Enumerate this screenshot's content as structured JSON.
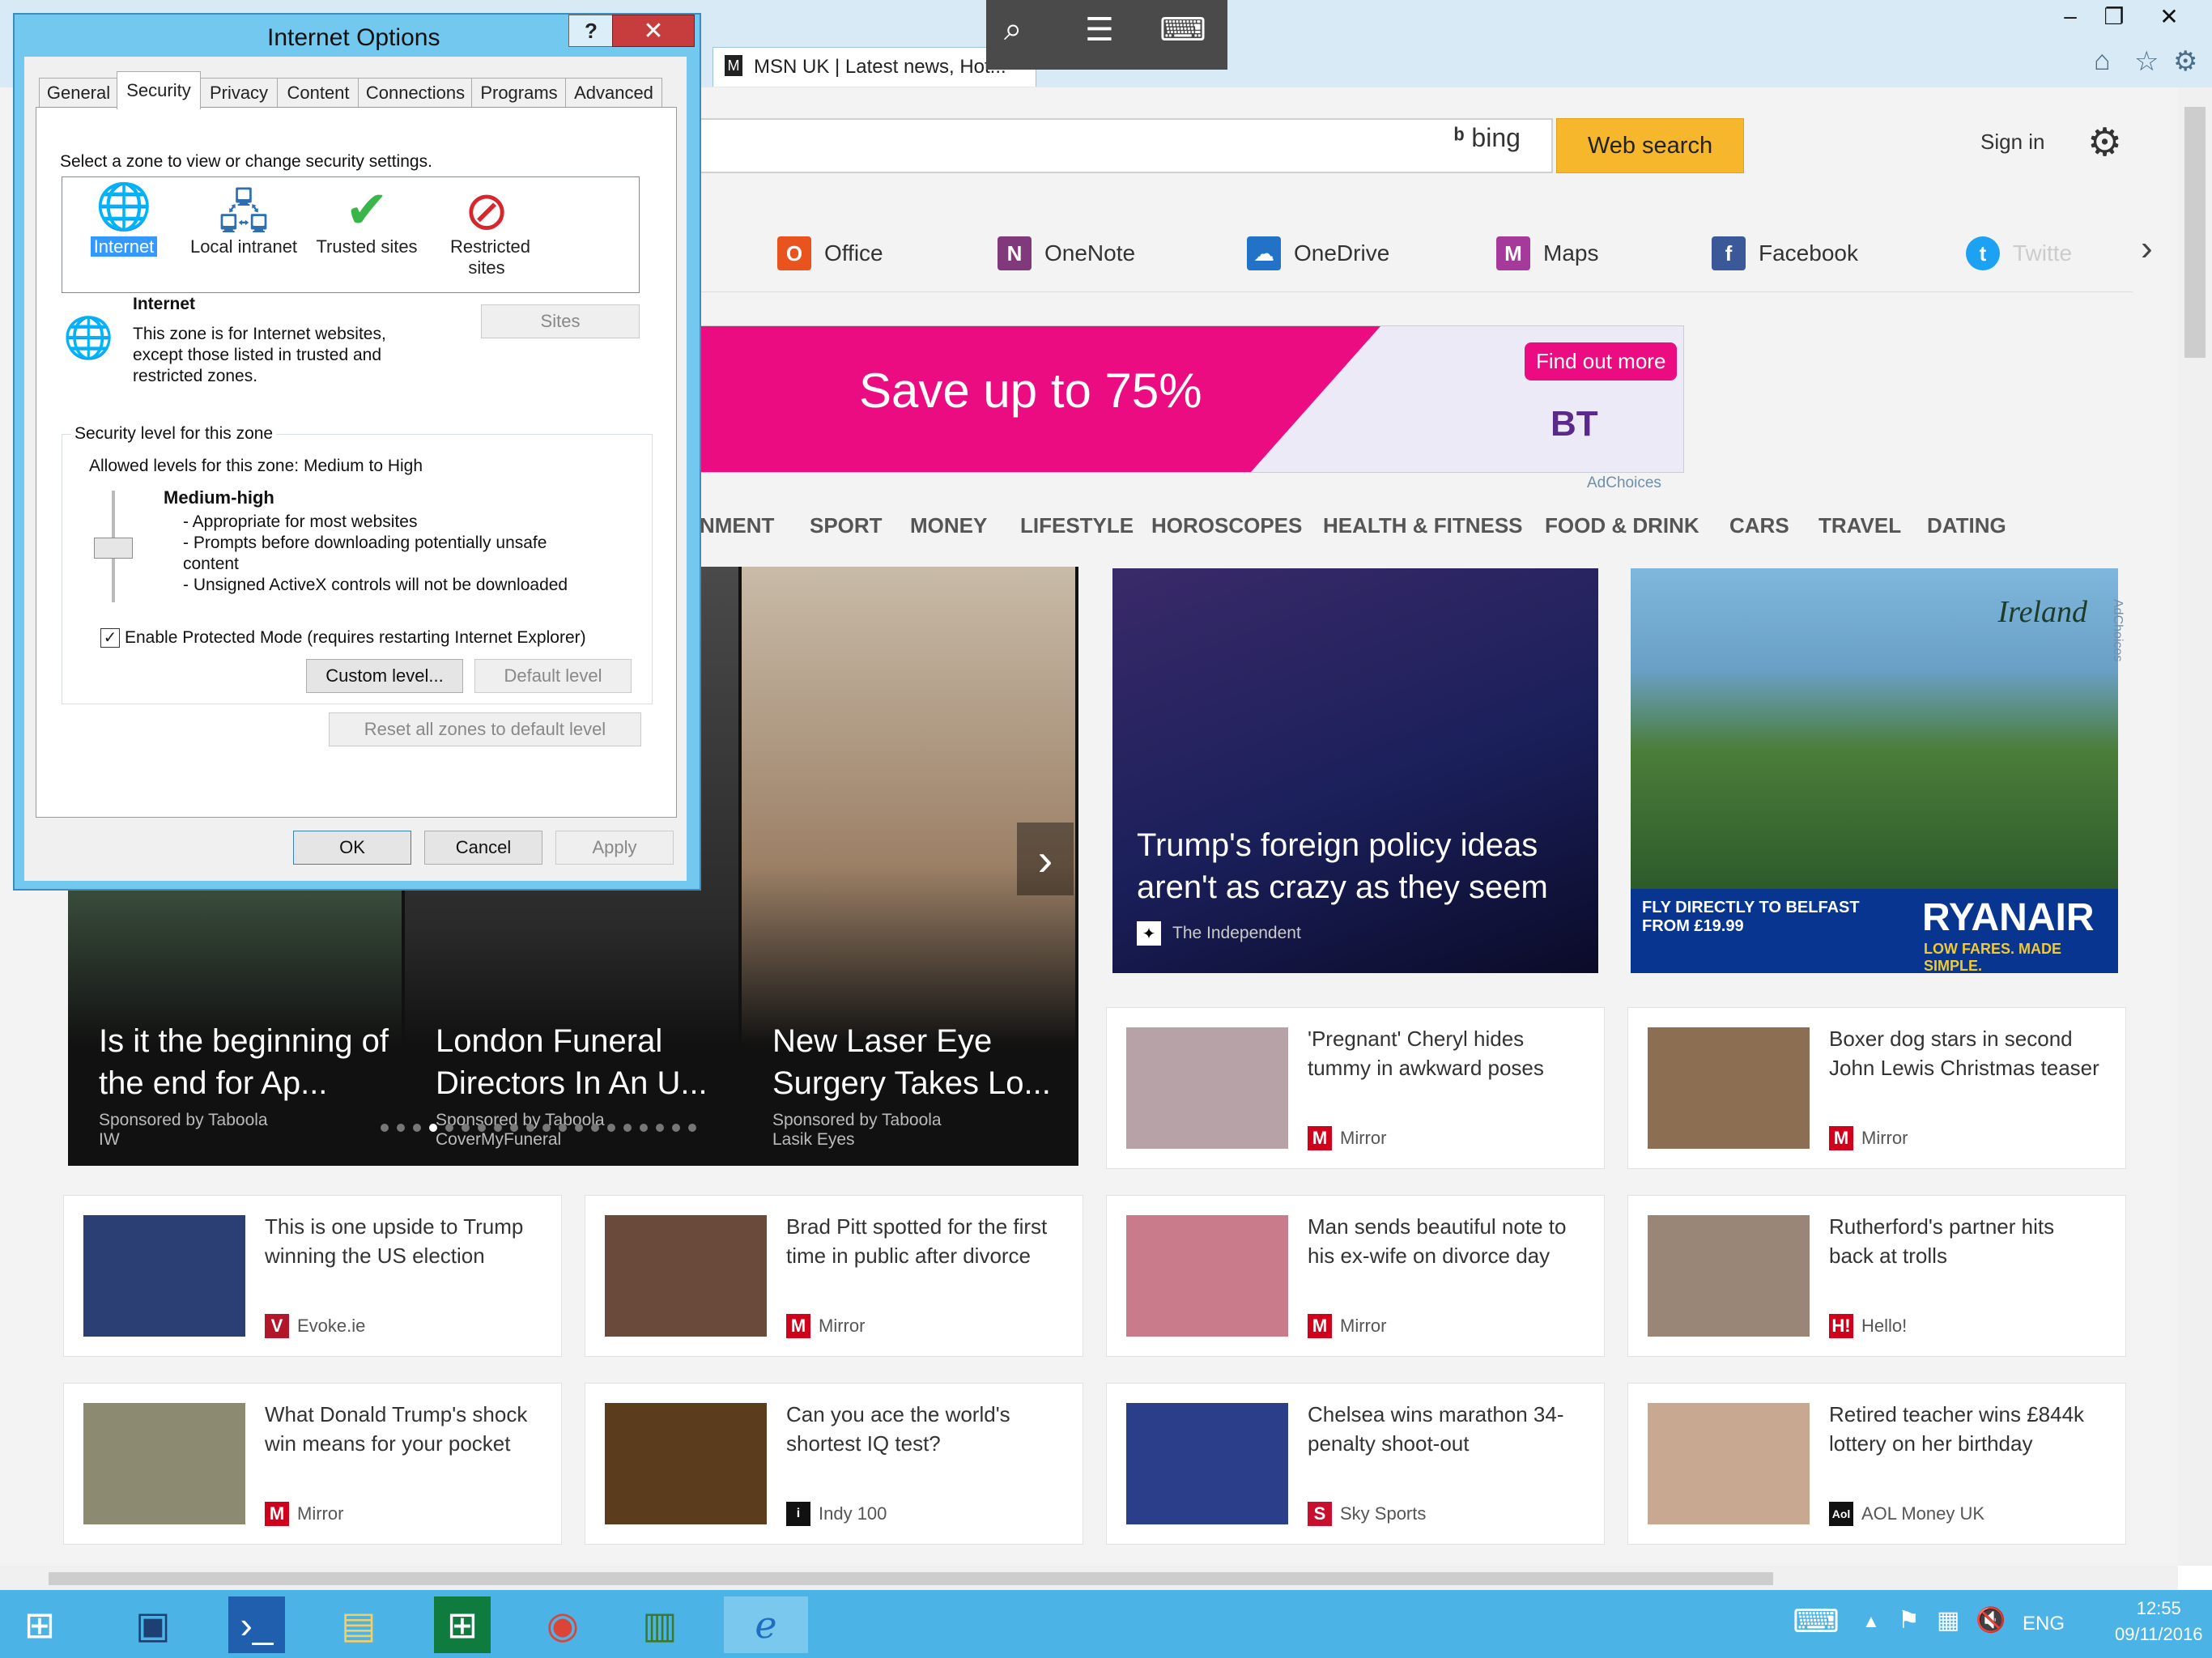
{
  "browser": {
    "tab_title": "MSN UK | Latest news, Hot...",
    "tab_close": "×",
    "window_buttons": [
      "–",
      "❐",
      "✕"
    ],
    "chrome_icons": [
      "home-icon",
      "star-icon",
      "gear-icon"
    ]
  },
  "msn": {
    "bing_label": "bing",
    "web_search": "Web search",
    "sign_in": "Sign in",
    "apps": [
      {
        "label": "Office",
        "color": "#e8531e",
        "glyph": "O"
      },
      {
        "label": "OneNote",
        "color": "#80397b",
        "glyph": "N"
      },
      {
        "label": "OneDrive",
        "color": "#2272c8",
        "glyph": "☁"
      },
      {
        "label": "Maps",
        "color": "#a53a9a",
        "glyph": "M"
      },
      {
        "label": "Facebook",
        "color": "#3b5998",
        "glyph": "f"
      },
      {
        "label": "Twitte",
        "color": "#1da1f2",
        "glyph": "t"
      }
    ],
    "ad_top": {
      "headline": "Save up to 75%",
      "cta": "Find out more",
      "brand": "BT",
      "adchoices": "AdChoices"
    },
    "nav": [
      "NMENT",
      "SPORT",
      "MONEY",
      "LIFESTYLE",
      "HOROSCOPES",
      "HEALTH & FITNESS",
      "FOOD & DRINK",
      "CARS",
      "TRAVEL",
      "DATING"
    ],
    "slides": [
      {
        "caption": "Is it the beginning of the end for Ap...",
        "sponsor": "Sponsored by Taboola",
        "source": "IW"
      },
      {
        "caption": "London Funeral Directors In An U...",
        "sponsor": "Sponsored by Taboola",
        "source": "CoverMyFuneral"
      },
      {
        "caption": "New Laser Eye Surgery Takes Lo...",
        "sponsor": "Sponsored by Taboola",
        "source": "Lasik Eyes"
      }
    ],
    "feature": {
      "title": "Trump's foreign policy ideas aren't as crazy as they seem",
      "source": "The Independent"
    },
    "ad_side": {
      "brand": "Ireland",
      "text": "FLY DIRECTLY TO BELFAST FROM £19.99",
      "airline": "RYANAIR",
      "tagline": "LOW FARES. MADE SIMPLE.",
      "adchoices": "AdChoices"
    },
    "cards": [
      {
        "title": "'Pregnant' Cheryl hides tummy in awkward poses",
        "source": "Mirror",
        "logo": "M",
        "logo_color": "#d0021b",
        "thumb": "#b7a3a7"
      },
      {
        "title": "Boxer dog stars in second John Lewis Christmas teaser",
        "source": "Mirror",
        "logo": "M",
        "logo_color": "#d0021b",
        "thumb": "#8c6e52"
      },
      {
        "title": "This is one upside to Trump winning the US election",
        "source": "Evoke.ie",
        "logo": "V",
        "logo_color": "#b3152b",
        "thumb": "#2b3f74"
      },
      {
        "title": "Brad Pitt spotted for the first time in public after divorce",
        "source": "Mirror",
        "logo": "M",
        "logo_color": "#d0021b",
        "thumb": "#6a4a3a"
      },
      {
        "title": "Man sends beautiful note to his ex-wife on divorce day",
        "source": "Mirror",
        "logo": "M",
        "logo_color": "#d0021b",
        "thumb": "#c97b8c"
      },
      {
        "title": "Rutherford's partner hits back at trolls",
        "source": "Hello!",
        "logo": "H!",
        "logo_color": "#d0021b",
        "thumb": "#9a8676"
      },
      {
        "title": "What Donald Trump's shock win means for your pocket",
        "source": "Mirror",
        "logo": "M",
        "logo_color": "#d0021b",
        "thumb": "#8d8a72"
      },
      {
        "title": "Can you ace the world's shortest IQ test?",
        "source": "Indy 100",
        "logo": "i",
        "logo_color": "#111111",
        "thumb": "#5b3d1e"
      },
      {
        "title": "Chelsea wins marathon 34-penalty shoot-out",
        "source": "Sky Sports",
        "logo": "S",
        "logo_color": "#c8102e",
        "thumb": "#2a3e8a"
      },
      {
        "title": "Retired teacher wins £844k lottery on her birthday",
        "source": "AOL Money UK",
        "logo": "Aol",
        "logo_color": "#111111",
        "thumb": "#c9a892"
      }
    ]
  },
  "dialog": {
    "title": "Internet Options",
    "help": "?",
    "close": "✕",
    "tabs": [
      "General",
      "Security",
      "Privacy",
      "Content",
      "Connections",
      "Programs",
      "Advanced"
    ],
    "select_zone_text": "Select a zone to view or change security settings.",
    "zones": [
      {
        "label": "Internet",
        "icon": "globe-icon",
        "glyph": "🌐"
      },
      {
        "label": "Local intranet",
        "icon": "intranet-icon",
        "glyph": "🖧"
      },
      {
        "label": "Trusted sites",
        "icon": "checkmark-icon",
        "glyph": "✔"
      },
      {
        "label": "Restricted sites",
        "icon": "no-entry-icon",
        "glyph": "⊘"
      }
    ],
    "zone_name": "Internet",
    "zone_desc": "This zone is for Internet websites, except those listed in trusted and restricted zones.",
    "sites_button": "Sites",
    "level_group": "Security level for this zone",
    "allowed_levels": "Allowed levels for this zone: Medium to High",
    "level_name": "Medium-high",
    "level_items": [
      "- Appropriate for most websites",
      "- Prompts before downloading potentially unsafe content",
      "- Unsigned ActiveX controls will not be downloaded"
    ],
    "protected_mode": "Enable Protected Mode (requires restarting Internet Explorer)",
    "protected_mode_checked": true,
    "custom_level": "Custom level...",
    "default_level": "Default level",
    "reset_all": "Reset all zones to default level",
    "ok": "OK",
    "cancel": "Cancel",
    "apply": "Apply"
  },
  "taskbar": {
    "lang": "ENG",
    "time": "12:55",
    "date": "09/11/2016"
  }
}
